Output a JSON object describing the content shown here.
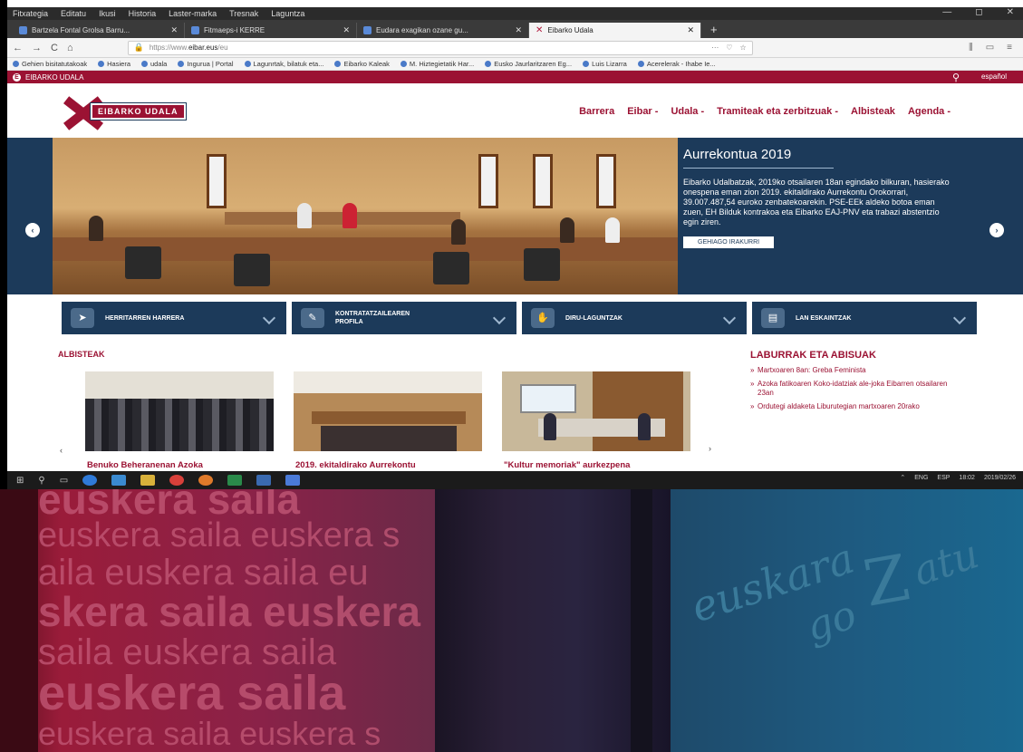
{
  "browser": {
    "menu": [
      "Fitxategia",
      "Editatu",
      "Ikusi",
      "Historia",
      "Laster-marka",
      "Tresnak",
      "Laguntza"
    ],
    "window_controls": [
      "—",
      "◻",
      "✕"
    ],
    "tabs": [
      {
        "label": "Bartzela Fontal Grolsa Barru...",
        "active": false
      },
      {
        "label": "Fitmaeps-i KERRE",
        "active": false
      },
      {
        "label": "Eudara exagikan ozane gu...",
        "active": false
      },
      {
        "label": "Eibarko Udala",
        "active": true
      }
    ],
    "new_tab": "+",
    "close_glyph": "✕",
    "nav": {
      "back": "←",
      "forward": "→",
      "reload": "C",
      "home": "⌂"
    },
    "url_prefix": "https://www.",
    "url_domain": "eibar.eus",
    "url_suffix": "/eu",
    "url_actions": [
      "···",
      "♡",
      "☆"
    ],
    "toolbar_right": [
      "⫼",
      "▭",
      "≡"
    ],
    "bookmarks": [
      "Gehien bisitatutakoak",
      "Hasiera",
      "udala",
      "Ingurua | Portal",
      "Lagunrtak, bilatuk eta...",
      "Eibarko Kaleak",
      "M. Hiztegietatik Har...",
      "Eusko Jaurlaritzaren Eg...",
      "Luis Lizarra",
      "Acerelerak - Ihabe Ie..."
    ]
  },
  "site": {
    "topbar_brand": "EIBARKO UDALA",
    "topbar_logo_glyph": "E",
    "search_icon": "⚲",
    "language": "español",
    "logo_text": "EIBARKO UDALA",
    "nav": [
      "Barrera",
      "Eibar -",
      "Udala -",
      "Tramiteak eta zerbitzuak -",
      "Albisteak",
      "Agenda -"
    ],
    "hero": {
      "title": "Aurrekontua 2019",
      "body": "Eibarko Udalbatzak, 2019ko otsailaren 18an egindako bilkuran, hasierako onespena eman zion 2019. ekitaldirako Aurrekontu Orokorrari, 39.007.487,54 euroko zenbatekoarekin. PSE-EEk aldeko botoa eman zuen, EH Bilduk kontrakoa eta Eibarko EAJ-PNV eta trabazi abstentzio egin ziren.",
      "button": "GEHIAGO IRAKURRI",
      "prev": "‹",
      "next": "›"
    },
    "quicklinks": [
      {
        "label": "HERRITARREN HARRERA",
        "icon": "megaphone-icon",
        "glyph": "➤"
      },
      {
        "label": "KONTRATATZAILEAREN PROFILA",
        "icon": "edit-icon",
        "glyph": "✎"
      },
      {
        "label": "DIRU-LAGUNTZAK",
        "icon": "hand-coin-icon",
        "glyph": "✋"
      },
      {
        "label": "LAN ESKAINTZAK",
        "icon": "document-icon",
        "glyph": "▤"
      }
    ],
    "news_heading": "ALBISTEAK",
    "news": [
      {
        "title": "Benuko Beheranenan Azoka"
      },
      {
        "title": "2019. ekitaldirako Aurrekontu"
      },
      {
        "title": "\"Kultur memoriak\" aurkezpena"
      }
    ],
    "news_prev": "‹",
    "news_next": "›",
    "notices_heading": "LABURRAK ETA ABISUAK",
    "notices": [
      "Martxoaren 8an: Greba Feminista",
      "Azoka fatikoaren Koko-idatziak ale-joka Eibarren otsailaren 23an",
      "Ordutegi aldaketa Liburutegian martxoaren 20rako"
    ]
  },
  "taskbar": {
    "start": "⊞",
    "search": "⚲",
    "taskview": "▭",
    "tray": [
      "⌃",
      "ENG",
      "ESP",
      "18:02",
      "2019/02/26"
    ]
  },
  "photo": {
    "wall_text_lines": [
      "euskera saila",
      "euskera saila euskera s",
      "aila euskera saila eu",
      "skera saila euskera",
      "saila euskera saila",
      "euskera saila",
      "euskera saila euskera s"
    ],
    "logo_word_1": "euskara",
    "logo_word_2": "go",
    "logo_word_3": "atu",
    "logo_letter_z": "Z"
  }
}
